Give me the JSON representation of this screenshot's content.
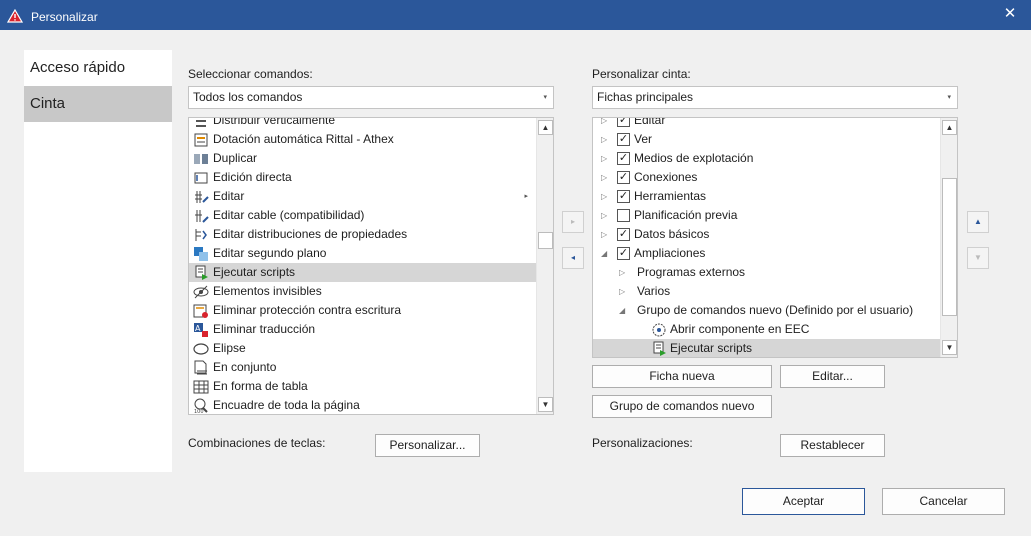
{
  "window": {
    "title": "Personalizar",
    "close_glyph": "✕"
  },
  "nav": {
    "items": [
      {
        "label": "Acceso rápido",
        "selected": false
      },
      {
        "label": "Cinta",
        "selected": true
      }
    ]
  },
  "commands": {
    "label": "Seleccionar comandos:",
    "combo_value": "Todos los comandos",
    "items": [
      {
        "label": "Distribuir verticalmente",
        "icon": "distribute-vertical-icon"
      },
      {
        "label": "Dotación automática Rittal - Athex",
        "icon": "auto-fitting-icon"
      },
      {
        "label": "Duplicar",
        "icon": "duplicate-icon"
      },
      {
        "label": "Edición directa",
        "icon": "direct-edit-icon"
      },
      {
        "label": "Editar",
        "icon": "edit-icon",
        "has_submenu": true
      },
      {
        "label": "Editar cable (compatibilidad)",
        "icon": "edit-cable-icon"
      },
      {
        "label": "Editar distribuciones de propiedades",
        "icon": "edit-property-distribution-icon"
      },
      {
        "label": "Editar segundo plano",
        "icon": "edit-background-icon"
      },
      {
        "label": "Ejecutar scripts",
        "icon": "run-scripts-icon",
        "selected": true
      },
      {
        "label": "Elementos invisibles",
        "icon": "invisible-elements-icon"
      },
      {
        "label": "Eliminar protección contra escritura",
        "icon": "remove-write-protection-icon"
      },
      {
        "label": "Eliminar traducción",
        "icon": "remove-translation-icon"
      },
      {
        "label": "Elipse",
        "icon": "ellipse-icon"
      },
      {
        "label": "En conjunto",
        "icon": "in-set-icon"
      },
      {
        "label": "En forma de tabla",
        "icon": "table-form-icon"
      },
      {
        "label": "Encuadre de toda la página",
        "icon": "fit-page-icon"
      }
    ]
  },
  "ribbon": {
    "label": "Personalizar cinta:",
    "combo_value": "Fichas principales",
    "items": [
      {
        "label": "Editar",
        "level": 0,
        "expander": "collapsed",
        "checked": true
      },
      {
        "label": "Ver",
        "level": 0,
        "expander": "collapsed",
        "checked": true
      },
      {
        "label": "Medios de explotación",
        "level": 0,
        "expander": "collapsed",
        "checked": true
      },
      {
        "label": "Conexiones",
        "level": 0,
        "expander": "collapsed",
        "checked": true
      },
      {
        "label": "Herramientas",
        "level": 0,
        "expander": "collapsed",
        "checked": true
      },
      {
        "label": "Planificación previa",
        "level": 0,
        "expander": "collapsed",
        "checked": false
      },
      {
        "label": "Datos básicos",
        "level": 0,
        "expander": "collapsed",
        "checked": true
      },
      {
        "label": "Ampliaciones",
        "level": 0,
        "expander": "expanded",
        "checked": true
      },
      {
        "label": "Programas externos",
        "level": 1,
        "expander": "collapsed"
      },
      {
        "label": "Varios",
        "level": 1,
        "expander": "collapsed"
      },
      {
        "label": "Grupo de comandos nuevo (Definido por el usuario)",
        "level": 1,
        "expander": "expanded"
      },
      {
        "label": "Abrir componente en EEC",
        "level": 2,
        "icon": "open-component-icon"
      },
      {
        "label": "Ejecutar scripts",
        "level": 2,
        "icon": "run-scripts-icon",
        "selected": true
      }
    ]
  },
  "buttons": {
    "add_glyph": "▸",
    "remove_glyph": "◂",
    "move_up_glyph": "▲",
    "move_down_glyph": "▼",
    "new_tab": "Ficha nueva",
    "edit": "Editar...",
    "new_group": "Grupo de comandos nuevo",
    "keyboard_label": "Combinaciones de teclas:",
    "customize": "Personalizar...",
    "customizations_label": "Personalizaciones:",
    "reset": "Restablecer",
    "ok": "Aceptar",
    "cancel": "Cancelar"
  },
  "scroll": {
    "up_glyph": "▲",
    "down_glyph": "▼",
    "combo_arrow": "▾",
    "submenu_glyph": "▸"
  },
  "colors": {
    "titlebar": "#2b579a",
    "selection": "#d6d6d6",
    "dialog_bg": "#f0f0f0"
  }
}
